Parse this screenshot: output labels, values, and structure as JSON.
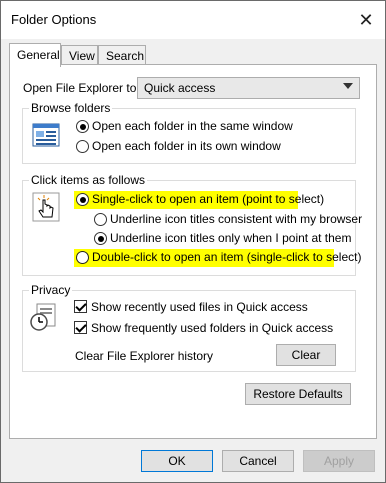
{
  "window": {
    "title": "Folder Options",
    "close_glyph": "✕"
  },
  "tabs": [
    {
      "label": "General",
      "active": true
    },
    {
      "label": "View",
      "active": false
    },
    {
      "label": "Search",
      "active": false
    }
  ],
  "open_explorer": {
    "label": "Open File Explorer to:",
    "value": "Quick access"
  },
  "browse_folders": {
    "legend": "Browse folders",
    "options": [
      {
        "label": "Open each folder in the same window",
        "checked": true
      },
      {
        "label": "Open each folder in its own window",
        "checked": false
      }
    ]
  },
  "click_items": {
    "legend": "Click items as follows",
    "single_click": "Single-click to open an item (point to select)",
    "underline_consistent": "Underline icon titles consistent with my browser",
    "underline_point": "Underline icon titles only when I point at them",
    "double_click": "Double-click to open an item (single-click to select)"
  },
  "privacy": {
    "legend": "Privacy",
    "show_recent_files": "Show recently used files in Quick access",
    "show_frequent_folders": "Show frequently used folders in Quick access",
    "clear_history_label": "Clear File Explorer history",
    "clear_button": "Clear"
  },
  "restore_defaults": "Restore Defaults",
  "footer": {
    "ok": "OK",
    "cancel": "Cancel",
    "apply": "Apply"
  },
  "colors": {
    "highlight": "#ffff00",
    "accent": "#0078d7"
  }
}
